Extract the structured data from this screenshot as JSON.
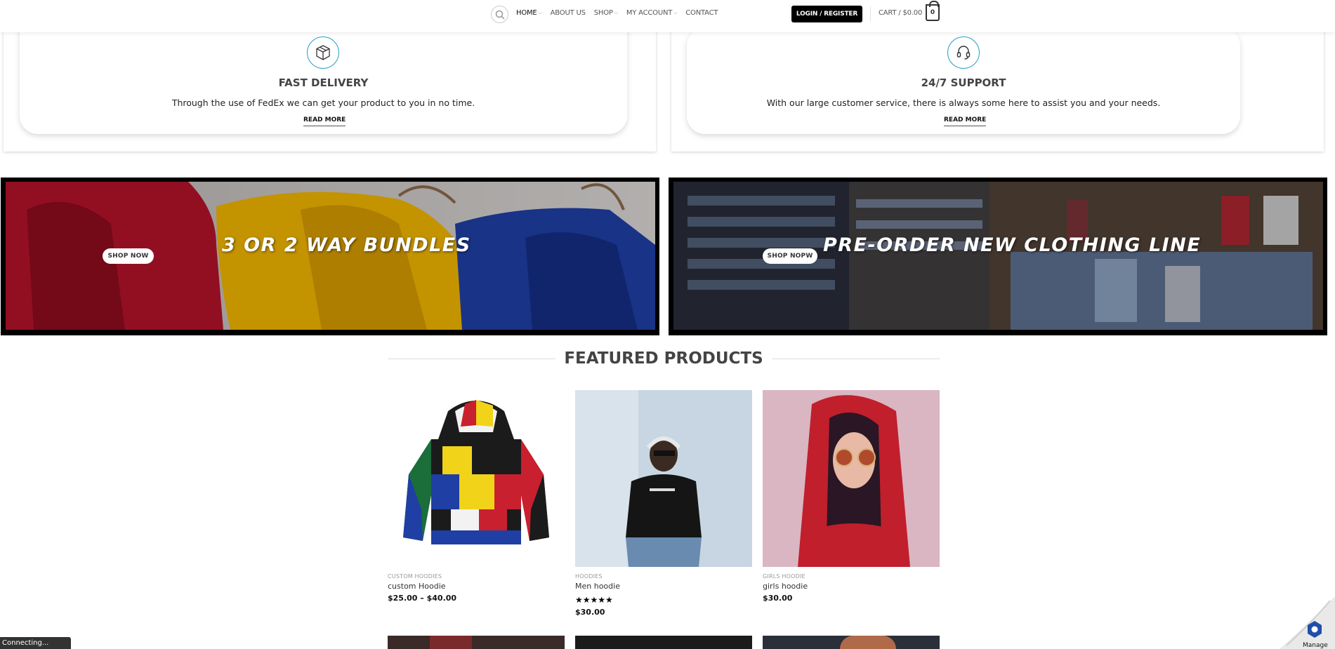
{
  "header": {
    "nav": [
      {
        "label": "HOME",
        "caret": true,
        "active": true
      },
      {
        "label": "ABOUT US",
        "caret": false
      },
      {
        "label": "SHOP",
        "caret": true
      },
      {
        "label": "MY ACCOUNT",
        "caret": true
      },
      {
        "label": "CONTACT",
        "caret": false
      }
    ],
    "login_label": "LOGIN / REGISTER",
    "cart_label": "CART / $0.00",
    "cart_count": "0"
  },
  "features": [
    {
      "icon": "box-icon",
      "title": "FAST DELIVERY",
      "text": "Through the use of FedEx we can get your product to you in no time.",
      "link": "READ MORE"
    },
    {
      "icon": "headset-icon",
      "title": "24/7 SUPPORT",
      "text": "With our large customer service, there is always some here to assist you and your needs.",
      "link": "READ MORE"
    }
  ],
  "banners": [
    {
      "title": "3 OR 2 WAY BUNDLES",
      "button": "SHOP NOW"
    },
    {
      "title": "PRE-ORDER NEW CLOTHING LINE",
      "button": "SHOP NOPW"
    }
  ],
  "featured": {
    "title": "FEATURED PRODUCTS",
    "products": [
      {
        "category": "CUSTOM HOODIES",
        "name": "custom Hoodie",
        "price": "$25.00 – $40.00",
        "rating": null
      },
      {
        "category": "HOODIES",
        "name": "Men hoodie",
        "price": "$30.00",
        "rating": "★★★★★"
      },
      {
        "category": "GIRLS HOODIE",
        "name": "girls hoodie",
        "price": "$30.00",
        "rating": null
      }
    ]
  },
  "status": {
    "text": "Connecting..."
  },
  "manage": {
    "label": "Manage"
  }
}
